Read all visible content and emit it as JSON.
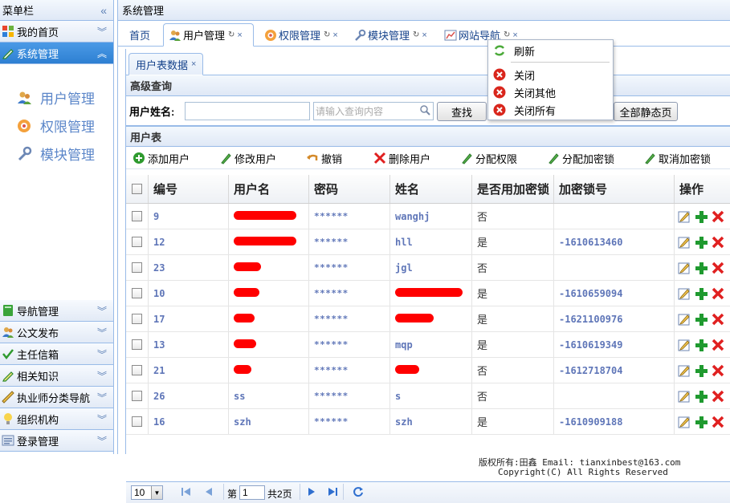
{
  "sidebar": {
    "title": "菜单栏",
    "collapse_glyph": "«",
    "top_items": [
      {
        "label": "我的首页",
        "icon": "windows-grid-icon"
      },
      {
        "label": "系统管理",
        "icon": "pencil-icon"
      }
    ],
    "sys_links": [
      {
        "label": "用户管理",
        "icon": "users-icon"
      },
      {
        "label": "权限管理",
        "icon": "permission-icon"
      },
      {
        "label": "模块管理",
        "icon": "wrench-icon"
      }
    ],
    "bottom_items": [
      {
        "label": "导航管理",
        "icon": "book-icon"
      },
      {
        "label": "公文发布",
        "icon": "users-icon"
      },
      {
        "label": "主任信箱",
        "icon": "checkmark-icon"
      },
      {
        "label": "相关知识",
        "icon": "pencil-icon"
      },
      {
        "label": "执业师分类导航",
        "icon": "ruler-icon"
      },
      {
        "label": "组织机构",
        "icon": "bulb-icon"
      },
      {
        "label": "登录管理",
        "icon": "list-icon"
      }
    ]
  },
  "main": {
    "title": "系统管理",
    "tabs": [
      {
        "label": "首页"
      },
      {
        "label": "用户管理",
        "icon": "users-icon"
      },
      {
        "label": "权限管理",
        "icon": "permission-icon"
      },
      {
        "label": "模块管理",
        "icon": "wrench-icon"
      },
      {
        "label": "网站导航",
        "icon": "chart-icon"
      }
    ],
    "tab_refresh_glyph": "↻",
    "tab_close_glyph": "×",
    "inner_tab": "用户表数据",
    "query": {
      "section_title": "高级查询",
      "username_label": "用户姓名:",
      "search_placeholder": "请输入查询内容",
      "search_button": "查找",
      "static_button": "全部静态页"
    },
    "table_title": "用户表",
    "toolbar": [
      {
        "label": "添加用户",
        "icon": "add-icon"
      },
      {
        "label": "修改用户",
        "icon": "edit-pencil-icon"
      },
      {
        "label": "撤销",
        "icon": "undo-icon"
      },
      {
        "label": "删除用户",
        "icon": "delete-icon"
      },
      {
        "label": "分配权限",
        "icon": "edit-pencil-icon"
      },
      {
        "label": "分配加密锁",
        "icon": "edit-pencil-icon"
      },
      {
        "label": "取消加密锁",
        "icon": "edit-pencil-icon"
      }
    ],
    "columns": [
      "编号",
      "用户名",
      "密码",
      "姓名",
      "是否用加密锁",
      "加密锁号",
      "操作"
    ],
    "rows": [
      {
        "id": "9",
        "username": "",
        "password": "******",
        "name": "wanghj",
        "uses_lock": "否",
        "lock_no": ""
      },
      {
        "id": "12",
        "username": "",
        "password": "******",
        "name": "hll",
        "uses_lock": "是",
        "lock_no": "-1610613460"
      },
      {
        "id": "23",
        "username": "",
        "password": "******",
        "name": "jgl",
        "uses_lock": "否",
        "lock_no": ""
      },
      {
        "id": "10",
        "username": "",
        "password": "******",
        "name": "",
        "uses_lock": "是",
        "lock_no": "-1610659094"
      },
      {
        "id": "17",
        "username": "",
        "password": "******",
        "name": "",
        "uses_lock": "是",
        "lock_no": "-1621100976"
      },
      {
        "id": "13",
        "username": "",
        "password": "******",
        "name": "mqp",
        "uses_lock": "是",
        "lock_no": "-1610619349"
      },
      {
        "id": "21",
        "username": "",
        "password": "******",
        "name": "",
        "uses_lock": "否",
        "lock_no": "-1612718704"
      },
      {
        "id": "26",
        "username": "ss",
        "password": "******",
        "name": "s",
        "uses_lock": "否",
        "lock_no": ""
      },
      {
        "id": "16",
        "username": "szh",
        "password": "******",
        "name": "szh",
        "uses_lock": "是",
        "lock_no": "-1610909188"
      }
    ],
    "pager": {
      "page_size": "10",
      "page_label": "第",
      "page_value": "1",
      "total": "共2页"
    }
  },
  "context_menu": {
    "items": [
      {
        "label": "刷新",
        "icon": "refresh-icon"
      },
      {
        "label": "关闭",
        "icon": "close-circle-icon"
      },
      {
        "label": "关闭其他",
        "icon": "close-circle-icon"
      },
      {
        "label": "关闭所有",
        "icon": "close-circle-icon"
      }
    ]
  },
  "footer": {
    "line1": "版权所有:田鑫 Email: tianxinbest@163.com",
    "line2": "Copyright(C) All Rights Reserved"
  },
  "colors": {
    "border": "#99bbe8",
    "active_menu": "#2d7fd2",
    "link": "#5b86c9",
    "mono_value": "#5f76b8",
    "redaction": "#ff0000"
  }
}
